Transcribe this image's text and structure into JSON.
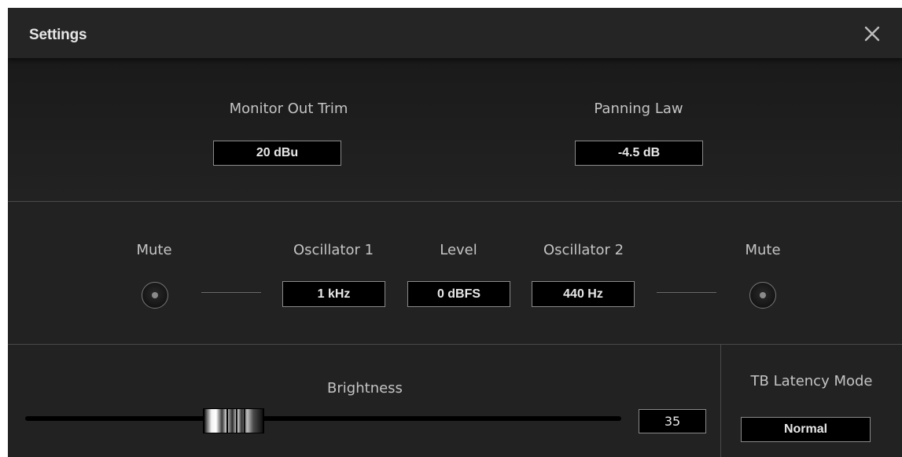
{
  "window": {
    "title": "Settings",
    "close_icon": "close-icon"
  },
  "monitor_out_trim": {
    "label": "Monitor Out Trim",
    "value": "20 dBu"
  },
  "panning_law": {
    "label": "Panning Law",
    "value": "-4.5 dB"
  },
  "oscillators": {
    "mute_left_label": "Mute",
    "oscillator1_label": "Oscillator 1",
    "oscillator1_value": "1 kHz",
    "level_label": "Level",
    "level_value": "0 dBFS",
    "oscillator2_label": "Oscillator 2",
    "oscillator2_value": "440 Hz",
    "mute_right_label": "Mute"
  },
  "brightness": {
    "label": "Brightness",
    "value": "35",
    "level": 0.35
  },
  "tb_latency": {
    "label": "TB Latency Mode",
    "value": "Normal"
  },
  "colors": {
    "window_bg": "#222222",
    "titlebar_bg": "#252525",
    "value_box_bg": "#000000",
    "value_box_border": "#8a8a8a",
    "label_text": "#c4c4c4"
  }
}
